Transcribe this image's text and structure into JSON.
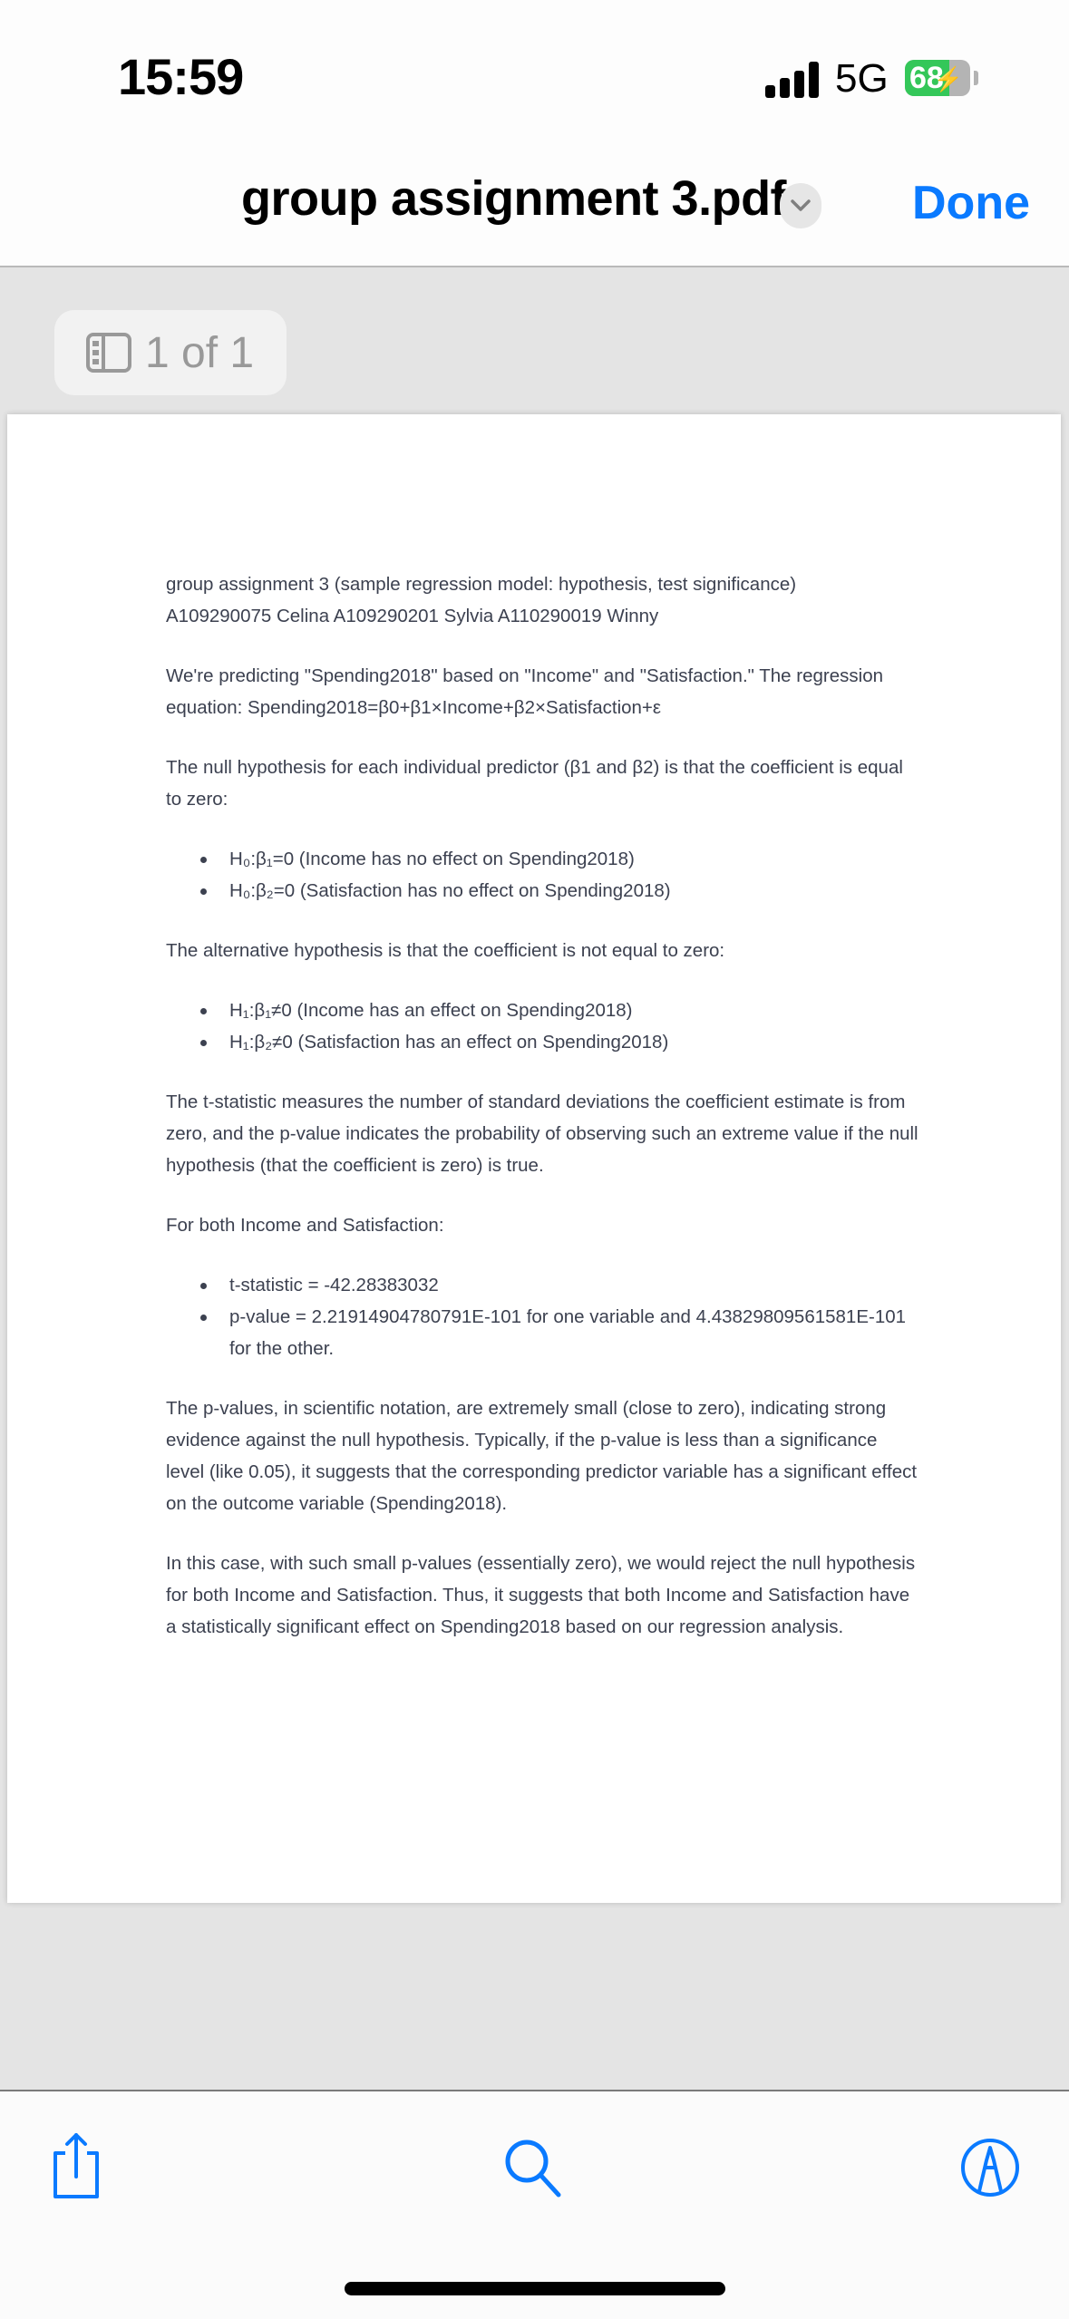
{
  "status_bar": {
    "time": "15:59",
    "network": "5G",
    "battery_percent": "68",
    "battery_level": 0.68,
    "charging": true
  },
  "header": {
    "title": "group assignment 3.pdf",
    "done_label": "Done"
  },
  "page_indicator": {
    "label": "1 of 1"
  },
  "document": {
    "title_line": "group assignment 3 (sample regression model: hypothesis, test significance)",
    "authors_line": "A109290075 Celina A109290201 Sylvia A110290019 Winny",
    "intro": "We're predicting \"Spending2018\" based on \"Income\" and \"Satisfaction.\" The regression equation: Spending2018=β0+β1×Income+β2×Satisfaction+ε",
    "null_intro": "The null hypothesis for each individual predictor (β1 and β2) is that the coefficient is equal to zero:",
    "null_items": [
      "H₀:β₁=0 (Income has no effect on Spending2018)",
      "H₀:β₂=0 (Satisfaction has no effect on Spending2018)"
    ],
    "alt_intro": "The alternative hypothesis is that the coefficient is not equal to zero:",
    "alt_items": [
      "H₁:β₁≠0 (Income has an effect on Spending2018)",
      "H₁:β₂≠0 (Satisfaction has an effect on Spending2018)"
    ],
    "tstat_explain": "The t-statistic measures the number of standard deviations the coefficient estimate is from zero, and the p-value indicates the probability of observing such an extreme value if the null hypothesis (that the coefficient is zero) is true.",
    "both_intro": "For both Income and Satisfaction:",
    "stat_items": [
      "t-statistic = -42.28383032",
      "p-value = 2.21914904780791E-101 for one variable and 4.43829809561581E-101 for the other."
    ],
    "pvalue_explain": "The p-values, in scientific notation, are extremely small (close to zero), indicating strong evidence against the null hypothesis. Typically, if the p-value is less than a significance level (like 0.05), it suggests that the corresponding predictor variable has a significant effect on the outcome variable (Spending2018).",
    "conclusion": "In this case, with such small p-values (essentially zero), we would reject the null hypothesis for both Income and Satisfaction. Thus, it suggests that both Income and Satisfaction have a statistically significant effect on Spending2018 based on our regression analysis."
  },
  "toolbar": {
    "share_icon": "share-icon",
    "search_icon": "search-icon",
    "markup_icon": "markup-pen-icon"
  },
  "colors": {
    "accent": "#0a7aff",
    "battery_green": "#34c759"
  }
}
